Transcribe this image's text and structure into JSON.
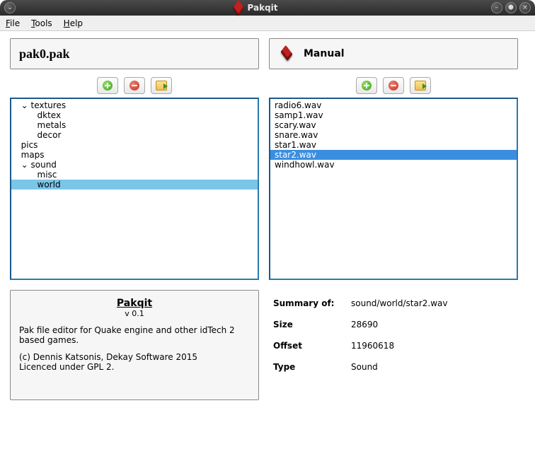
{
  "window": {
    "title": "Pakqit"
  },
  "menu": {
    "file": "File",
    "tools": "Tools",
    "help": "Help"
  },
  "left_panel": {
    "title": "pak0.pak"
  },
  "right_panel": {
    "title": "Manual"
  },
  "tree": [
    {
      "text": "textures",
      "depth": 0,
      "expander": "⌄",
      "selected": false
    },
    {
      "text": "dktex",
      "depth": 1,
      "expander": "",
      "selected": false
    },
    {
      "text": "metals",
      "depth": 1,
      "expander": "",
      "selected": false
    },
    {
      "text": "decor",
      "depth": 1,
      "expander": "",
      "selected": false
    },
    {
      "text": "pics",
      "depth": 0,
      "expander": "",
      "selected": false
    },
    {
      "text": "maps",
      "depth": 0,
      "expander": "",
      "selected": false
    },
    {
      "text": "sound",
      "depth": 0,
      "expander": "⌄",
      "selected": false
    },
    {
      "text": "misc",
      "depth": 1,
      "expander": "",
      "selected": false
    },
    {
      "text": "world",
      "depth": 1,
      "expander": "",
      "selected": true
    }
  ],
  "files": [
    {
      "name": "radio6.wav",
      "selected": false
    },
    {
      "name": "samp1.wav",
      "selected": false
    },
    {
      "name": "scary.wav",
      "selected": false
    },
    {
      "name": "snare.wav",
      "selected": false
    },
    {
      "name": "star1.wav",
      "selected": false
    },
    {
      "name": "star2.wav",
      "selected": true
    },
    {
      "name": "windhowl.wav",
      "selected": false
    }
  ],
  "about": {
    "title": "Pakqit",
    "version": "v 0.1",
    "desc": "Pak file editor for Quake engine and other idTech 2 based games.",
    "copyright": "(c) Dennis Katsonis, Dekay Software 2015",
    "license": "Licenced under GPL 2."
  },
  "summary": {
    "heading_label": "Summary of:",
    "heading_value": "sound/world/star2.wav",
    "size_label": "Size",
    "size_value": "28690",
    "offset_label": "Offset",
    "offset_value": "11960618",
    "type_label": "Type",
    "type_value": "Sound"
  }
}
